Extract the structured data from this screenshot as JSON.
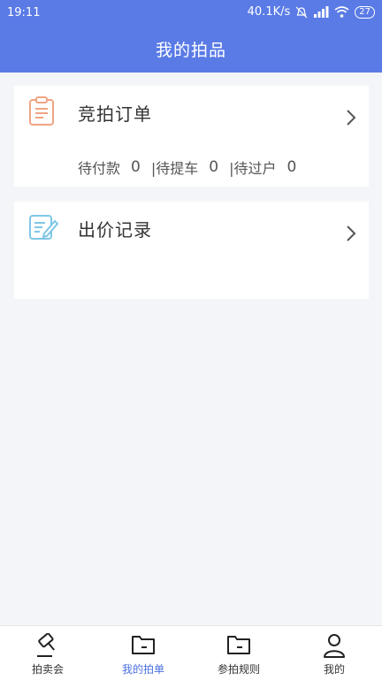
{
  "status_bar": {
    "time": "19:11",
    "network_speed": "40.1K/s",
    "battery": "27"
  },
  "header": {
    "title": "我的拍品"
  },
  "cards": {
    "orders": {
      "title": "竞拍订单",
      "stats": [
        {
          "label": "待付款",
          "count": "0"
        },
        {
          "label": "|待提车",
          "count": "0"
        },
        {
          "label": "|待过户",
          "count": "0"
        }
      ]
    },
    "bids": {
      "title": "出价记录"
    }
  },
  "tabbar": {
    "items": [
      {
        "label": "拍卖会",
        "icon": "gavel-icon"
      },
      {
        "label": "我的拍单",
        "icon": "folder-icon"
      },
      {
        "label": "参拍规则",
        "icon": "folder-icon"
      },
      {
        "label": "我的",
        "icon": "person-icon"
      }
    ],
    "active_index": 1
  },
  "colors": {
    "header": "#5a7be6",
    "active_tab": "#4a6fe0",
    "orders_icon": "#f0a483",
    "bids_icon": "#7fc7e6"
  }
}
